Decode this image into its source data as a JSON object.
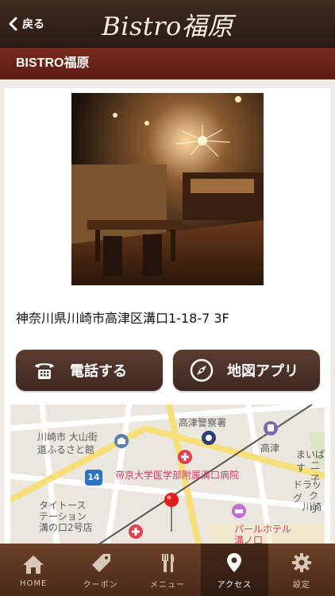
{
  "header": {
    "back_label": "戻る",
    "logo_text": "Bistro福原"
  },
  "page": {
    "title": "BISTRO福原"
  },
  "shop": {
    "address": "神奈川県川崎市高津区溝口1-18-7 3F"
  },
  "actions": {
    "call_label": "電話する",
    "map_label": "地図アプリ"
  },
  "map": {
    "labels": {
      "police": "高津警察署",
      "museum_1": "川崎市 大山街",
      "museum_2": "道ふるさと館",
      "station": "高津",
      "hospital": "帝京大学医学部附属溝口病院",
      "road_num": "14",
      "drug_1": "ドラッグ",
      "drug_2": "クリ",
      "drug_3": "川崎",
      "mai": "まいばす",
      "ni": "二子",
      "tyto_1": "タイトース",
      "tyto_2": "テーション",
      "tyto_3": "溝の口2号店",
      "hotel_1": "パールホテル",
      "hotel_2": "溝ノ口"
    }
  },
  "tabs": [
    {
      "label": "HOME",
      "icon": "home-icon"
    },
    {
      "label": "クーポン",
      "icon": "coupon-icon"
    },
    {
      "label": "メニュー",
      "icon": "menu-icon"
    },
    {
      "label": "アクセス",
      "icon": "access-icon",
      "active": true
    },
    {
      "label": "設定",
      "icon": "settings-icon"
    }
  ],
  "colors": {
    "header_bg": "#2f1f17",
    "title_bar_bg": "#6a2318",
    "button_bg": "#4a3027",
    "tabbar_bg": "#5a3520"
  }
}
